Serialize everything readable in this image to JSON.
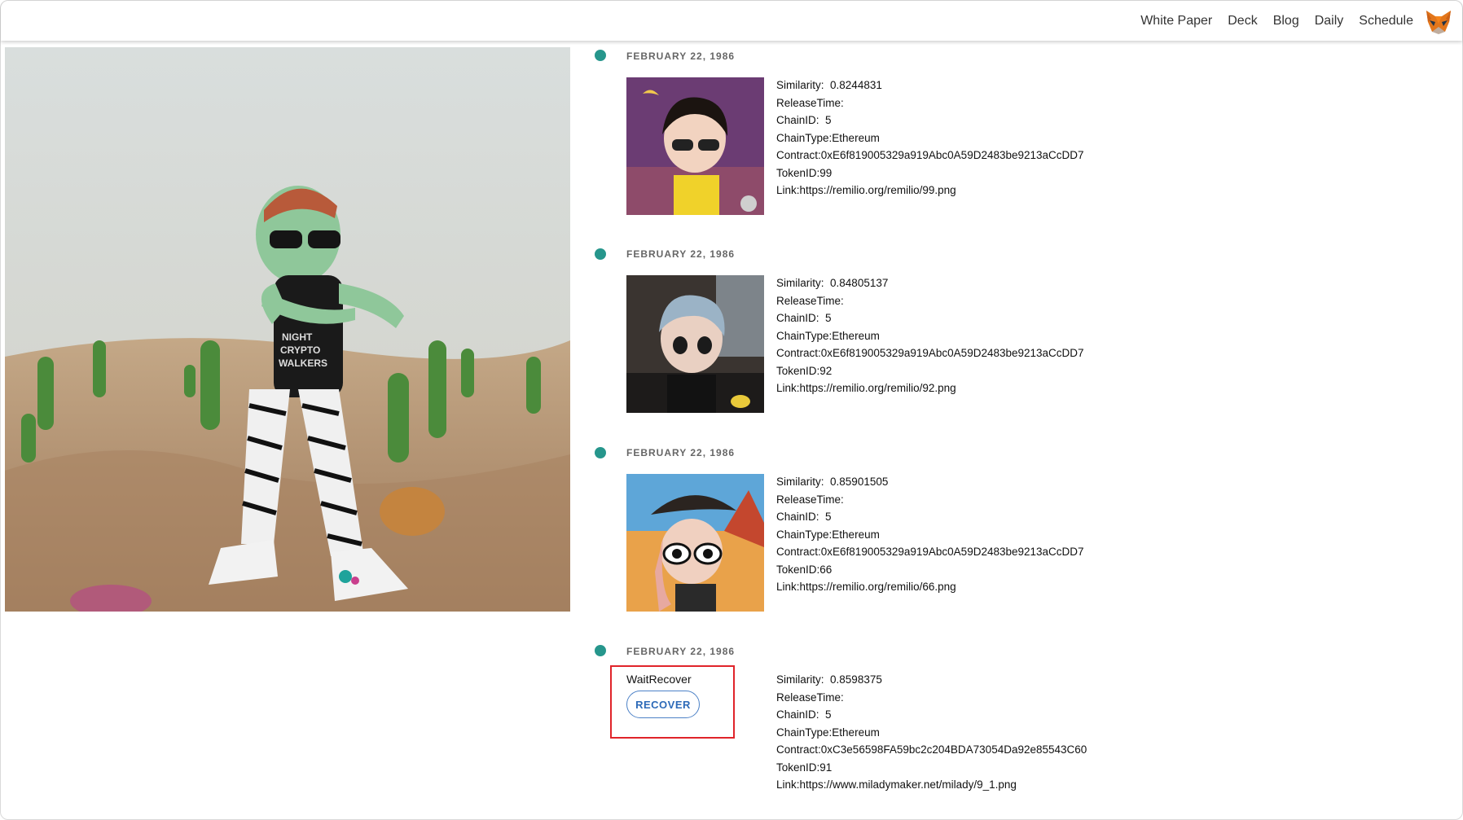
{
  "nav": {
    "items": [
      "White Paper",
      "Deck",
      "Blog",
      "Daily",
      "Schedule"
    ],
    "wallet_icon": "metamask-fox-icon"
  },
  "colors": {
    "accent_dot": "#26968c",
    "highlight_box": "#e0242a",
    "button_text": "#2d6ab8"
  },
  "labels": {
    "similarity": "Similarity:",
    "release_time": "ReleaseTime:",
    "chain_id": "ChainID:",
    "chain_type": "ChainType:",
    "contract": "Contract:",
    "token_id": "TokenID:",
    "link": "Link:"
  },
  "timeline": [
    {
      "date": "FEBRUARY 22, 1986",
      "similarity": "0.8244831",
      "release_time": "",
      "chain_id": "5",
      "chain_type": "Ethereum",
      "contract": "0xE6f819005329a919Abc0A59D2483be9213aCcDD7",
      "token_id": "99",
      "link": "https://remilio.org/remilio/99.png"
    },
    {
      "date": "FEBRUARY 22, 1986",
      "similarity": "0.84805137",
      "release_time": "",
      "chain_id": "5",
      "chain_type": "Ethereum",
      "contract": "0xE6f819005329a919Abc0A59D2483be9213aCcDD7",
      "token_id": "92",
      "link": "https://remilio.org/remilio/92.png"
    },
    {
      "date": "FEBRUARY 22, 1986",
      "similarity": "0.85901505",
      "release_time": "",
      "chain_id": "5",
      "chain_type": "Ethereum",
      "contract": "0xE6f819005329a919Abc0A59D2483be9213aCcDD7",
      "token_id": "66",
      "link": "https://remilio.org/remilio/66.png"
    },
    {
      "date": "FEBRUARY 22, 1986",
      "status": "WaitRecover",
      "button": "RECOVER",
      "similarity": "0.8598375",
      "release_time": "",
      "chain_id": "5",
      "chain_type": "Ethereum",
      "contract": "0xC3e56598FA59bc2c204BDA73054Da92e85543C60",
      "token_id": "91",
      "link": "https://www.miladymaker.net/milady/9_1.png"
    }
  ]
}
